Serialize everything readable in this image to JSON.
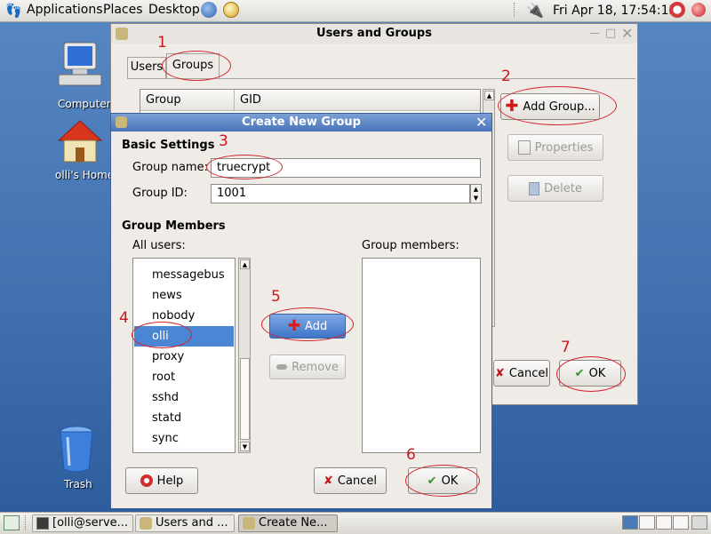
{
  "top_panel": {
    "menus": [
      "Applications",
      "Places",
      "Desktop"
    ],
    "clock": "Fri Apr 18, 17:54:13"
  },
  "desktop": {
    "icons": [
      "Computer",
      "olli's Home",
      "Trash"
    ]
  },
  "users_groups_window": {
    "title": "Users and Groups",
    "tabs": [
      "Users",
      "Groups"
    ],
    "columns": [
      "Group",
      "GID"
    ],
    "add_group": "Add Group...",
    "properties": "Properties",
    "delete": "Delete",
    "cancel": "Cancel",
    "ok": "OK"
  },
  "create_group_dialog": {
    "title": "Create New Group",
    "basic_settings": "Basic Settings",
    "group_name_label": "Group name:",
    "group_name_value": "truecrypt",
    "group_id_label": "Group ID:",
    "group_id_value": "1001",
    "group_members_heading": "Group Members",
    "all_users_label": "All users:",
    "group_members_label": "Group members:",
    "users": [
      "messagebus",
      "news",
      "nobody",
      "olli",
      "proxy",
      "root",
      "sshd",
      "statd",
      "sync"
    ],
    "selected_user": "olli",
    "add": "Add",
    "remove": "Remove",
    "help": "Help",
    "cancel": "Cancel",
    "ok": "OK"
  },
  "annotations": [
    "1",
    "2",
    "3",
    "4",
    "5",
    "6",
    "7"
  ],
  "taskbar": {
    "tasks": [
      "[olli@serve...",
      "Users and ...",
      "Create Ne..."
    ]
  },
  "colors": {
    "annotation": "#d3232a",
    "selection": "#4a86d4",
    "titlebar_active": "#4774bb"
  }
}
